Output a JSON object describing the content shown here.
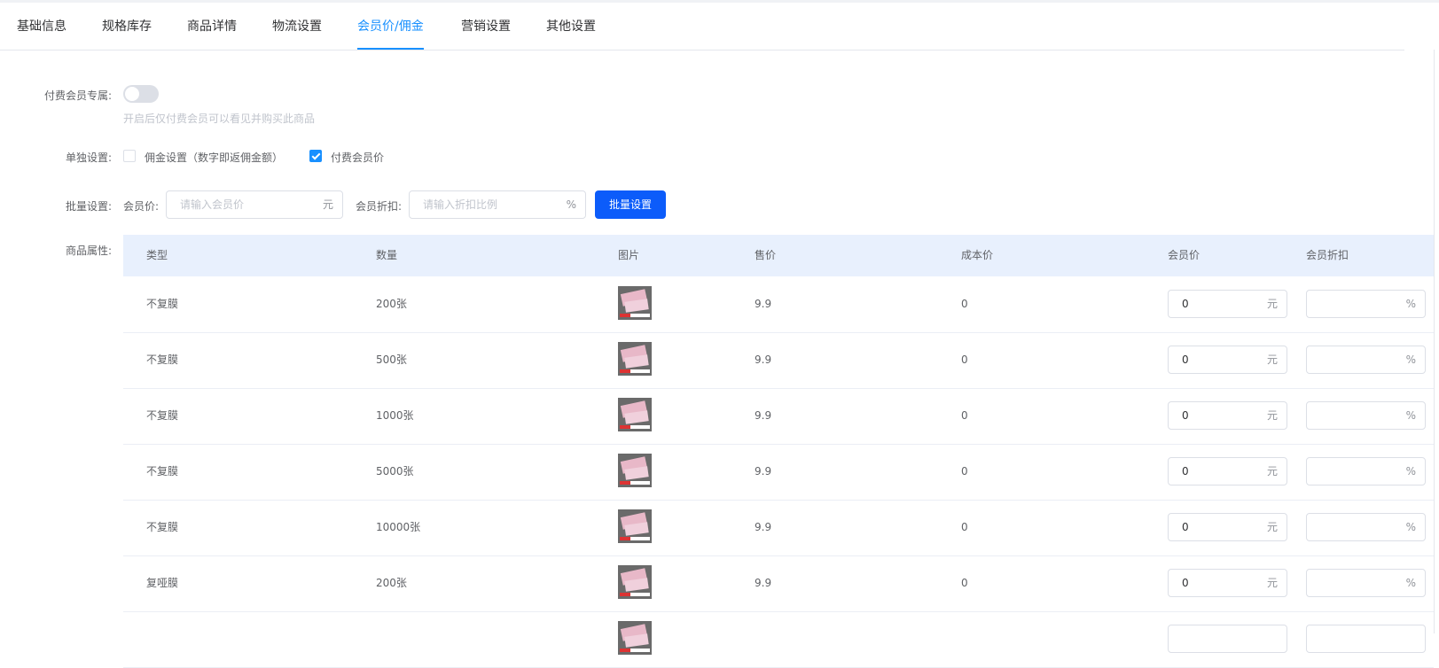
{
  "tabs": [
    "基础信息",
    "规格库存",
    "商品详情",
    "物流设置",
    "会员价/佣金",
    "营销设置",
    "其他设置"
  ],
  "active_tab_index": 4,
  "form": {
    "paid_member_label": "付费会员专属:",
    "paid_member_enabled": false,
    "paid_member_hint": "开启后仅付费会员可以看见并购买此商品",
    "separate_label": "单独设置:",
    "commission_checkbox": "佣金设置（数字即返佣金额）",
    "commission_checked": false,
    "member_price_checkbox": "付费会员价",
    "member_price_checked": true,
    "batch_label": "批量设置:",
    "batch_price_label": "会员价:",
    "batch_price_placeholder": "请输入会员价",
    "batch_price_suffix": "元",
    "batch_discount_label": "会员折扣:",
    "batch_discount_placeholder": "请输入折扣比例",
    "batch_discount_suffix": "%",
    "batch_button": "批量设置",
    "attributes_label": "商品属性:"
  },
  "table": {
    "headers": [
      "类型",
      "数量",
      "图片",
      "售价",
      "成本价",
      "会员价",
      "会员折扣"
    ],
    "price_suffix": "元",
    "discount_suffix": "%",
    "rows": [
      {
        "type": "不复膜",
        "qty": "200张",
        "price": "9.9",
        "cost": "0",
        "member_price": "0",
        "discount": ""
      },
      {
        "type": "不复膜",
        "qty": "500张",
        "price": "9.9",
        "cost": "0",
        "member_price": "0",
        "discount": ""
      },
      {
        "type": "不复膜",
        "qty": "1000张",
        "price": "9.9",
        "cost": "0",
        "member_price": "0",
        "discount": ""
      },
      {
        "type": "不复膜",
        "qty": "5000张",
        "price": "9.9",
        "cost": "0",
        "member_price": "0",
        "discount": ""
      },
      {
        "type": "不复膜",
        "qty": "10000张",
        "price": "9.9",
        "cost": "0",
        "member_price": "0",
        "discount": ""
      },
      {
        "type": "复哑膜",
        "qty": "200张",
        "price": "9.9",
        "cost": "0",
        "member_price": "0",
        "discount": ""
      },
      {
        "type": "",
        "qty": "",
        "price": "",
        "cost": "",
        "member_price": "",
        "discount": ""
      }
    ]
  },
  "colors": {
    "accent": "#1890ff",
    "primary_button": "#0c5cfa",
    "table_header_bg": "#e8f0fd"
  }
}
